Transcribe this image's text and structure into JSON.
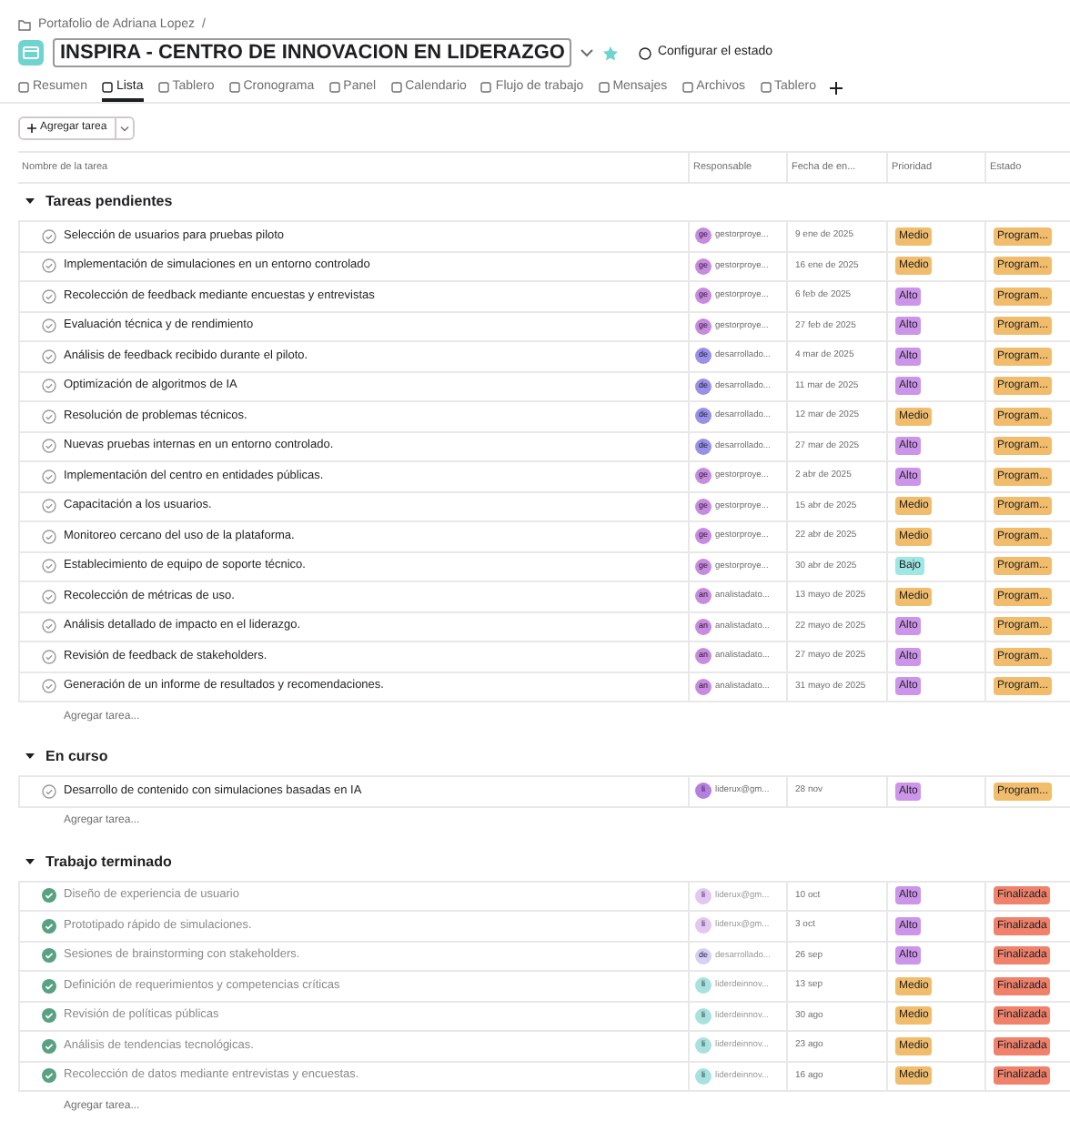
{
  "breadcrumb": "Portafolio de Adriana Lopez",
  "breadcrumb_separator": "/",
  "project_title": "INSPIRA - CENTRO DE INNOVACION EN LIDERAZGO",
  "status_button": "Configurar el estado",
  "tabs": [
    {
      "label": "Resumen",
      "selected": false
    },
    {
      "label": "Lista",
      "selected": true
    },
    {
      "label": "Tablero",
      "selected": false
    },
    {
      "label": "Cronograma",
      "selected": false
    },
    {
      "label": "Panel",
      "selected": false
    },
    {
      "label": "Calendario",
      "selected": false
    },
    {
      "label": "Flujo de trabajo",
      "selected": false
    },
    {
      "label": "Mensajes",
      "selected": false
    },
    {
      "label": "Archivos",
      "selected": false
    },
    {
      "label": "Tablero",
      "selected": false
    }
  ],
  "add_task_button": "Agregar tarea",
  "columns": [
    "Nombre de la tarea",
    "Responsable",
    "Fecha de en...",
    "Prioridad",
    "Estado"
  ],
  "sections": [
    {
      "title": "Tareas pendientes",
      "add_label": "Agregar tarea...",
      "tasks": [
        {
          "name": "Selección de usuarios para pruebas piloto",
          "completed": false,
          "assignee": {
            "initials": "ge",
            "name": "gestorproye...",
            "color": "#c88be0"
          },
          "date": "9 ene de 2025",
          "priority": {
            "label": "Medio",
            "color": "#f1bd6c"
          },
          "status": {
            "label": "Program...",
            "color": "#f1bd6c"
          }
        },
        {
          "name": "Implementación de simulaciones en un entorno controlado",
          "completed": false,
          "assignee": {
            "initials": "ge",
            "name": "gestorproye...",
            "color": "#c88be0"
          },
          "date": "16 ene de 2025",
          "priority": {
            "label": "Medio",
            "color": "#f1bd6c"
          },
          "status": {
            "label": "Program...",
            "color": "#f1bd6c"
          }
        },
        {
          "name": "Recolección de feedback mediante encuestas y entrevistas",
          "completed": false,
          "assignee": {
            "initials": "ge",
            "name": "gestorproye...",
            "color": "#c88be0"
          },
          "date": "6 feb de 2025",
          "priority": {
            "label": "Alto",
            "color": "#cd95ea"
          },
          "status": {
            "label": "Program...",
            "color": "#f1bd6c"
          }
        },
        {
          "name": "Evaluación técnica y de rendimiento",
          "completed": false,
          "assignee": {
            "initials": "ge",
            "name": "gestorproye...",
            "color": "#c88be0"
          },
          "date": "27 feb de 2025",
          "priority": {
            "label": "Alto",
            "color": "#cd95ea"
          },
          "status": {
            "label": "Program...",
            "color": "#f1bd6c"
          }
        },
        {
          "name": "Análisis de feedback recibido durante el piloto.",
          "completed": false,
          "assignee": {
            "initials": "de",
            "name": "desarrollado...",
            "color": "#9a90ea"
          },
          "date": "4 mar de 2025",
          "priority": {
            "label": "Alto",
            "color": "#cd95ea"
          },
          "status": {
            "label": "Program...",
            "color": "#f1bd6c"
          }
        },
        {
          "name": "Optimización de algoritmos de IA",
          "completed": false,
          "assignee": {
            "initials": "de",
            "name": "desarrollado...",
            "color": "#9a90ea"
          },
          "date": "11 mar de 2025",
          "priority": {
            "label": "Alto",
            "color": "#cd95ea"
          },
          "status": {
            "label": "Program...",
            "color": "#f1bd6c"
          }
        },
        {
          "name": "Resolución de problemas técnicos.",
          "completed": false,
          "assignee": {
            "initials": "de",
            "name": "desarrollado...",
            "color": "#9a90ea"
          },
          "date": "12 mar de 2025",
          "priority": {
            "label": "Medio",
            "color": "#f1bd6c"
          },
          "status": {
            "label": "Program...",
            "color": "#f1bd6c"
          }
        },
        {
          "name": "Nuevas pruebas internas en un entorno controlado.",
          "completed": false,
          "assignee": {
            "initials": "de",
            "name": "desarrollado...",
            "color": "#9a90ea"
          },
          "date": "27 mar de 2025",
          "priority": {
            "label": "Alto",
            "color": "#cd95ea"
          },
          "status": {
            "label": "Program...",
            "color": "#f1bd6c"
          }
        },
        {
          "name": "Implementación del centro en entidades públicas.",
          "completed": false,
          "assignee": {
            "initials": "ge",
            "name": "gestorproye...",
            "color": "#c88be0"
          },
          "date": "2 abr de 2025",
          "priority": {
            "label": "Alto",
            "color": "#cd95ea"
          },
          "status": {
            "label": "Program...",
            "color": "#f1bd6c"
          }
        },
        {
          "name": "Capacitación a los usuarios.",
          "completed": false,
          "assignee": {
            "initials": "ge",
            "name": "gestorproye...",
            "color": "#c88be0"
          },
          "date": "15 abr de 2025",
          "priority": {
            "label": "Medio",
            "color": "#f1bd6c"
          },
          "status": {
            "label": "Program...",
            "color": "#f1bd6c"
          }
        },
        {
          "name": "Monitoreo cercano del uso de la plataforma.",
          "completed": false,
          "assignee": {
            "initials": "ge",
            "name": "gestorproye...",
            "color": "#c88be0"
          },
          "date": "22 abr de 2025",
          "priority": {
            "label": "Medio",
            "color": "#f1bd6c"
          },
          "status": {
            "label": "Program...",
            "color": "#f1bd6c"
          }
        },
        {
          "name": "Establecimiento de equipo de soporte técnico.",
          "completed": false,
          "assignee": {
            "initials": "ge",
            "name": "gestorproye...",
            "color": "#c88be0"
          },
          "date": "30 abr de 2025",
          "priority": {
            "label": "Bajo",
            "color": "#9ee7e3"
          },
          "status": {
            "label": "Program...",
            "color": "#f1bd6c"
          }
        },
        {
          "name": "Recolección de métricas de uso.",
          "completed": false,
          "assignee": {
            "initials": "an",
            "name": "analistadato...",
            "color": "#c88be0"
          },
          "date": "13 mayo de 2025",
          "priority": {
            "label": "Medio",
            "color": "#f1bd6c"
          },
          "status": {
            "label": "Program...",
            "color": "#f1bd6c"
          }
        },
        {
          "name": "Análisis detallado de impacto en el liderazgo.",
          "completed": false,
          "assignee": {
            "initials": "an",
            "name": "analistadato...",
            "color": "#c88be0"
          },
          "date": "22 mayo de 2025",
          "priority": {
            "label": "Alto",
            "color": "#cd95ea"
          },
          "status": {
            "label": "Program...",
            "color": "#f1bd6c"
          }
        },
        {
          "name": "Revisión de feedback de stakeholders.",
          "completed": false,
          "assignee": {
            "initials": "an",
            "name": "analistadato...",
            "color": "#c88be0"
          },
          "date": "27 mayo de 2025",
          "priority": {
            "label": "Alto",
            "color": "#cd95ea"
          },
          "status": {
            "label": "Program...",
            "color": "#f1bd6c"
          }
        },
        {
          "name": "Generación de un informe de resultados y recomendaciones.",
          "completed": false,
          "assignee": {
            "initials": "an",
            "name": "analistadato...",
            "color": "#c88be0"
          },
          "date": "31 mayo de 2025",
          "priority": {
            "label": "Alto",
            "color": "#cd95ea"
          },
          "status": {
            "label": "Program...",
            "color": "#f1bd6c"
          }
        }
      ]
    },
    {
      "title": "En curso",
      "add_label": "Agregar tarea...",
      "tasks": [
        {
          "name": "Desarrollo de contenido con simulaciones basadas en IA",
          "completed": false,
          "assignee": {
            "initials": "li",
            "name": "liderux@gm...",
            "color": "#b57fe0"
          },
          "date": "28 nov",
          "priority": {
            "label": "Alto",
            "color": "#cd95ea"
          },
          "status": {
            "label": "Program...",
            "color": "#f1bd6c"
          }
        }
      ]
    },
    {
      "title": "Trabajo terminado",
      "add_label": "Agregar tarea...",
      "tasks": [
        {
          "name": "Diseño de experiencia de usuario",
          "completed": true,
          "assignee": {
            "initials": "li",
            "name": "liderux@gm...",
            "color": "#e3c6f2"
          },
          "date": "10 oct",
          "priority": {
            "label": "Alto",
            "color": "#cd95ea"
          },
          "status": {
            "label": "Finalizada",
            "color": "#f0826c"
          }
        },
        {
          "name": "Prototipado rápido de simulaciones.",
          "completed": true,
          "assignee": {
            "initials": "li",
            "name": "liderux@gm...",
            "color": "#e3c6f2"
          },
          "date": "3 oct",
          "priority": {
            "label": "Alto",
            "color": "#cd95ea"
          },
          "status": {
            "label": "Finalizada",
            "color": "#f0826c"
          }
        },
        {
          "name": "Sesiones de brainstorming con stakeholders.",
          "completed": true,
          "assignee": {
            "initials": "de",
            "name": "desarrollado...",
            "color": "#d4d0f6"
          },
          "date": "26 sep",
          "priority": {
            "label": "Alto",
            "color": "#cd95ea"
          },
          "status": {
            "label": "Finalizada",
            "color": "#f0826c"
          }
        },
        {
          "name": "Definición de requerimientos y competencias críticas",
          "completed": true,
          "assignee": {
            "initials": "li",
            "name": "liderdeinnov...",
            "color": "#a8e2df"
          },
          "date": "13 sep",
          "priority": {
            "label": "Medio",
            "color": "#f1bd6c"
          },
          "status": {
            "label": "Finalizada",
            "color": "#f0826c"
          }
        },
        {
          "name": "Revisión de políticas públicas",
          "completed": true,
          "assignee": {
            "initials": "li",
            "name": "liderdeinnov...",
            "color": "#a8e2df"
          },
          "date": "30 ago",
          "priority": {
            "label": "Medio",
            "color": "#f1bd6c"
          },
          "status": {
            "label": "Finalizada",
            "color": "#f0826c"
          }
        },
        {
          "name": "Análisis de tendencias tecnológicas.",
          "completed": true,
          "assignee": {
            "initials": "li",
            "name": "liderdeinnov...",
            "color": "#a8e2df"
          },
          "date": "23 ago",
          "priority": {
            "label": "Medio",
            "color": "#f1bd6c"
          },
          "status": {
            "label": "Finalizada",
            "color": "#f0826c"
          }
        },
        {
          "name": "Recolección de datos mediante entrevistas y encuestas.",
          "completed": true,
          "assignee": {
            "initials": "li",
            "name": "liderdeinnov...",
            "color": "#a8e2df"
          },
          "date": "16 ago",
          "priority": {
            "label": "Medio",
            "color": "#f1bd6c"
          },
          "status": {
            "label": "Finalizada",
            "color": "#f0826c"
          }
        }
      ]
    }
  ]
}
